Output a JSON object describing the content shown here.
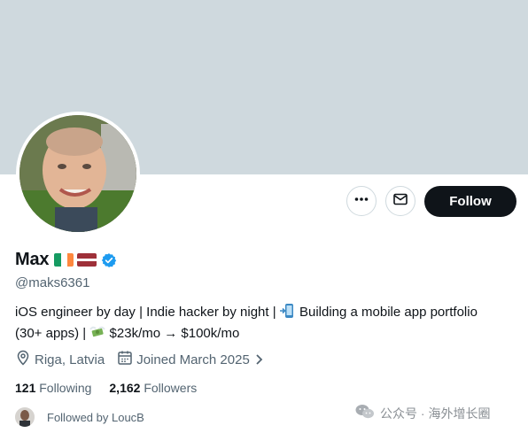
{
  "profile": {
    "name": "Max",
    "handle": "@maks6361",
    "bio_line1": "iOS engineer by day | Indie hacker by night | ",
    "bio_line1b": " Building a mobile app portfolio",
    "bio_line2a": "(30+ apps) | ",
    "bio_line2b": " $23k/mo → $100k/mo",
    "location": "Riga, Latvia",
    "joined": "Joined March 2025"
  },
  "actions": {
    "follow_label": "Follow"
  },
  "stats": {
    "following_count": "121",
    "following_label": "Following",
    "followers_count": "2,162",
    "followers_label": "Followers"
  },
  "followed_by": {
    "text": "Followed by LoucB"
  },
  "watermark": {
    "text": "公众号 · 海外增长圈"
  },
  "icons": {
    "more": "more-horizontal-icon",
    "message": "envelope-icon",
    "verified": "verified-badge-icon",
    "location": "location-pin-icon",
    "calendar": "calendar-icon",
    "chevron": "chevron-right-icon",
    "flags": [
      "ireland-flag-icon",
      "latvia-flag-icon"
    ],
    "bio_emoji": [
      "phone-arrow-emoji-icon",
      "money-wings-emoji-icon"
    ]
  },
  "colors": {
    "banner": "#cfd9de",
    "text_primary": "#0f1419",
    "text_secondary": "#536471",
    "follow_button": "#0f1419",
    "verified": "#1d9bf0"
  }
}
